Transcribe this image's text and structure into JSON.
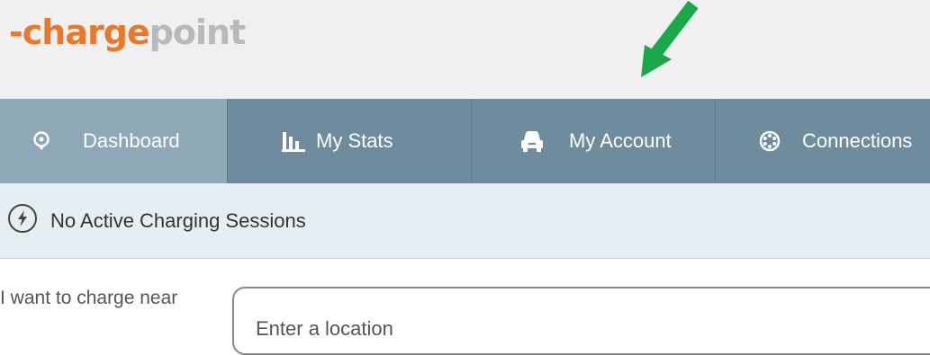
{
  "logo": {
    "prefix": "-",
    "part1": "charge",
    "part2": "point"
  },
  "nav": {
    "items": [
      {
        "label": "Dashboard",
        "icon": "location-pin-icon",
        "active": true
      },
      {
        "label": "My Stats",
        "icon": "bar-chart-icon"
      },
      {
        "label": "My Account",
        "icon": "car-icon"
      },
      {
        "label": "Connections",
        "icon": "connections-icon"
      }
    ]
  },
  "status": {
    "text": "No Active Charging Sessions",
    "icon": "lightning-icon"
  },
  "search": {
    "label": "I want to charge near",
    "placeholder": "Enter a location"
  },
  "annotation": {
    "icon": "arrow-icon",
    "color": "#1aa84a"
  },
  "colors": {
    "brand_orange": "#e8782b",
    "nav_bg": "#6f8c9f",
    "nav_active": "#8fa8b8",
    "status_bg": "#e6eef3"
  }
}
